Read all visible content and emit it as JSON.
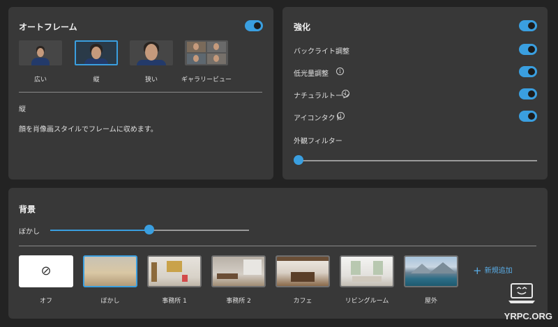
{
  "auto_frame": {
    "title": "オートフレーム",
    "toggle_on": true,
    "options": [
      {
        "label": "広い",
        "selected": false
      },
      {
        "label": "縦",
        "selected": true
      },
      {
        "label": "狭い",
        "selected": false
      },
      {
        "label": "ギャラリービュー",
        "selected": false
      }
    ],
    "selected_name": "縦",
    "description": "顔を肖像画スタイルでフレームに収めます。"
  },
  "enhance": {
    "title": "強化",
    "toggle_on": true,
    "items": [
      {
        "label": "バックライト調整",
        "info": false,
        "on": true
      },
      {
        "label": "低光量調整",
        "info": true,
        "on": true
      },
      {
        "label": "ナチュラルトーン",
        "info": true,
        "on": true
      },
      {
        "label": "アイコンタクト",
        "info": true,
        "on": true
      }
    ],
    "filter_label": "外観フィルター",
    "filter_value": 0
  },
  "background": {
    "title": "背景",
    "blur_label": "ぼかし",
    "blur_value": 0.5,
    "tiles": [
      {
        "label": "オフ",
        "selected": false
      },
      {
        "label": "ぼかし",
        "selected": true
      },
      {
        "label": "事務所 1",
        "selected": false
      },
      {
        "label": "事務所 2",
        "selected": false
      },
      {
        "label": "カフェ",
        "selected": false
      },
      {
        "label": "リビングルーム",
        "selected": false
      },
      {
        "label": "屋外",
        "selected": false
      }
    ],
    "add_label": "新規追加",
    "off_icon": "⊘"
  },
  "watermark": "YRPC.ORG",
  "colors": {
    "accent": "#3a9fe0",
    "panel": "#383838",
    "page": "#232323"
  }
}
